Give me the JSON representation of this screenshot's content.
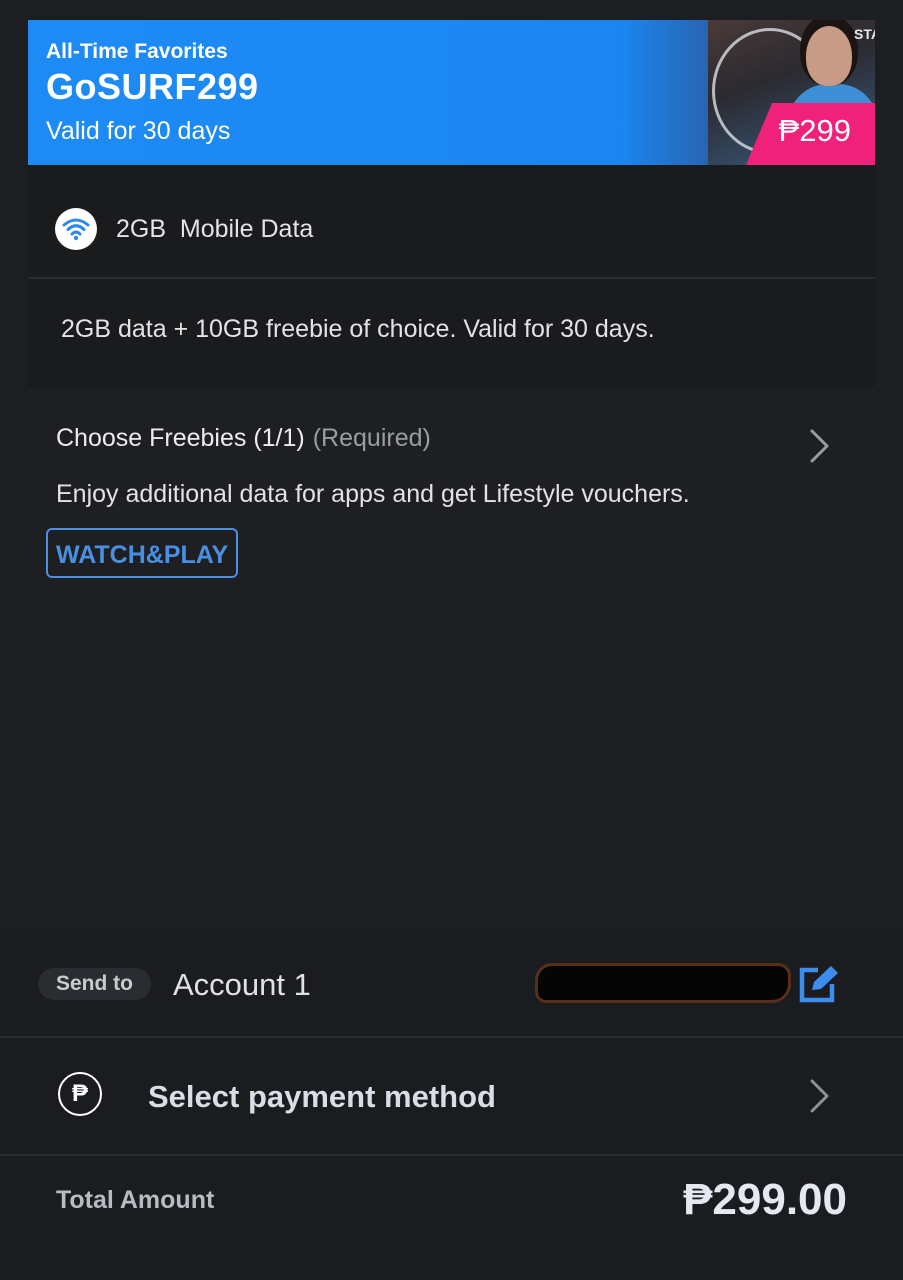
{
  "plan": {
    "eyebrow": "All-Time Favorites",
    "name": "GoSURF299",
    "validity": "Valid for 30 days",
    "price_badge": "₱299",
    "brand_color": "#1e8bf5",
    "badge_color": "#f0217a"
  },
  "inclusions": {
    "icon": "wifi-icon",
    "data_label": "2GB  Mobile Data"
  },
  "description": "2GB data + 10GB freebie of choice. Valid for 30 days.",
  "freebies": {
    "title": "Choose Freebies (1/1)",
    "required": "(Required)",
    "subtitle": "Enjoy additional data for apps and get Lifestyle vouchers.",
    "selected_tag": "WATCH&PLAY",
    "accent_color": "#4a90e2"
  },
  "checkout": {
    "send_to_label": "Send to",
    "account_name": "Account 1",
    "payment_label": "Select payment method",
    "payment_icon": "peso-icon",
    "total_label": "Total Amount",
    "total_value": "₱299.00"
  }
}
